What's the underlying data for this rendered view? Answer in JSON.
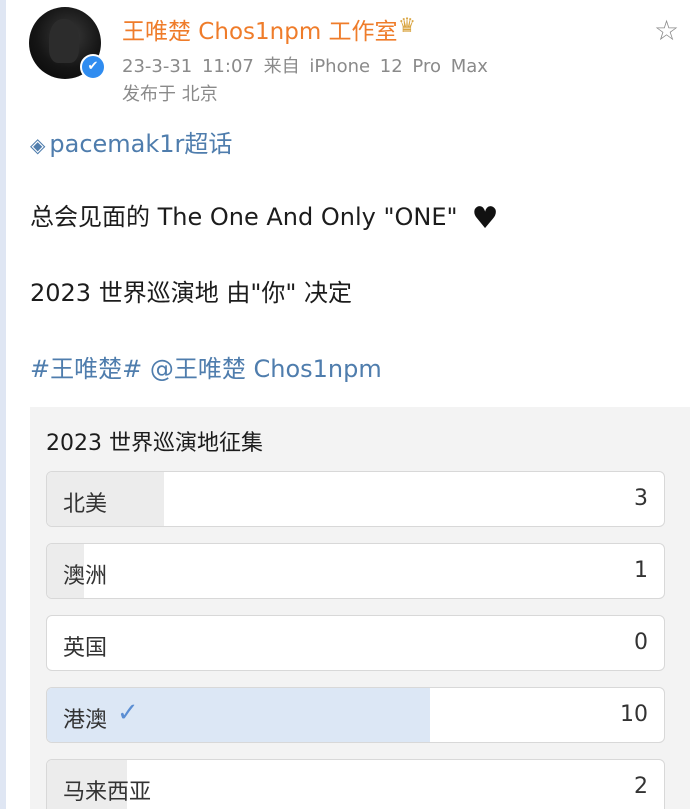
{
  "post": {
    "author": "王唯楚 Chos1npm 工作室",
    "timestamp": "23-3-31 11:07",
    "source": "来自 iPhone 12 Pro Max",
    "location": "发布于 北京",
    "topic": "pacemak1r超话",
    "line1": "总会见面的  The One And Only \"ONE\"",
    "line2": "2023 世界巡演地  由\"你\" 决定",
    "tags": "#王唯楚# @王唯楚 Chos1npm"
  },
  "icons": {
    "verified": "✔",
    "crown": "♛",
    "star": "☆",
    "gem": "◈",
    "heart": "♥",
    "check": "✓"
  },
  "poll": {
    "title": "2023 世界巡演地征集",
    "options": [
      {
        "label": "北美",
        "count": "3",
        "fraction": 0.19
      },
      {
        "label": "澳洲",
        "count": "1",
        "fraction": 0.06
      },
      {
        "label": "英国",
        "count": "0",
        "fraction": 0.0
      },
      {
        "label": "港澳",
        "count": "10",
        "fraction": 0.62,
        "voted": true
      },
      {
        "label": "马来西亚",
        "count": "2",
        "fraction": 0.13
      }
    ]
  }
}
